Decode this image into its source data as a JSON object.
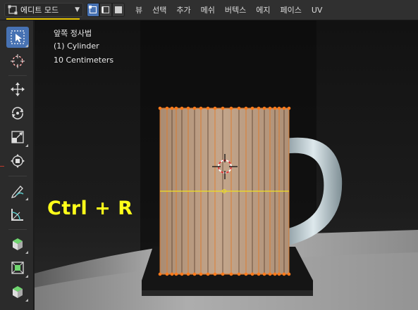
{
  "header": {
    "mode_label": "에디트 모드",
    "mode_icon": "edit-mode-icon",
    "select_modes": [
      "vertex-select-icon",
      "edge-select-icon",
      "face-select-icon"
    ],
    "menus": [
      "뷰",
      "선택",
      "추가",
      "메쉬",
      "버텍스",
      "에지",
      "페이스",
      "UV"
    ],
    "accent_color": "#e8c400"
  },
  "toolbar": {
    "tools": [
      "select-box-icon",
      "cursor-icon",
      "move-icon",
      "rotate-icon",
      "scale-icon",
      "transform-icon",
      "annotate-icon",
      "measure-icon",
      "add-cube-icon",
      "extrude-icon",
      "inset-icon"
    ],
    "active_color": "#4772b3"
  },
  "viewport": {
    "view_name": "앞쪽 정사법",
    "object_name": "(1) Cylinder",
    "scale_label": "10 Centimeters",
    "shortcut": "Ctrl + R",
    "shortcut_color": "#ffff1a",
    "loop_cut_color": "#f0e020",
    "vertex_color": "#ff7a1a"
  }
}
